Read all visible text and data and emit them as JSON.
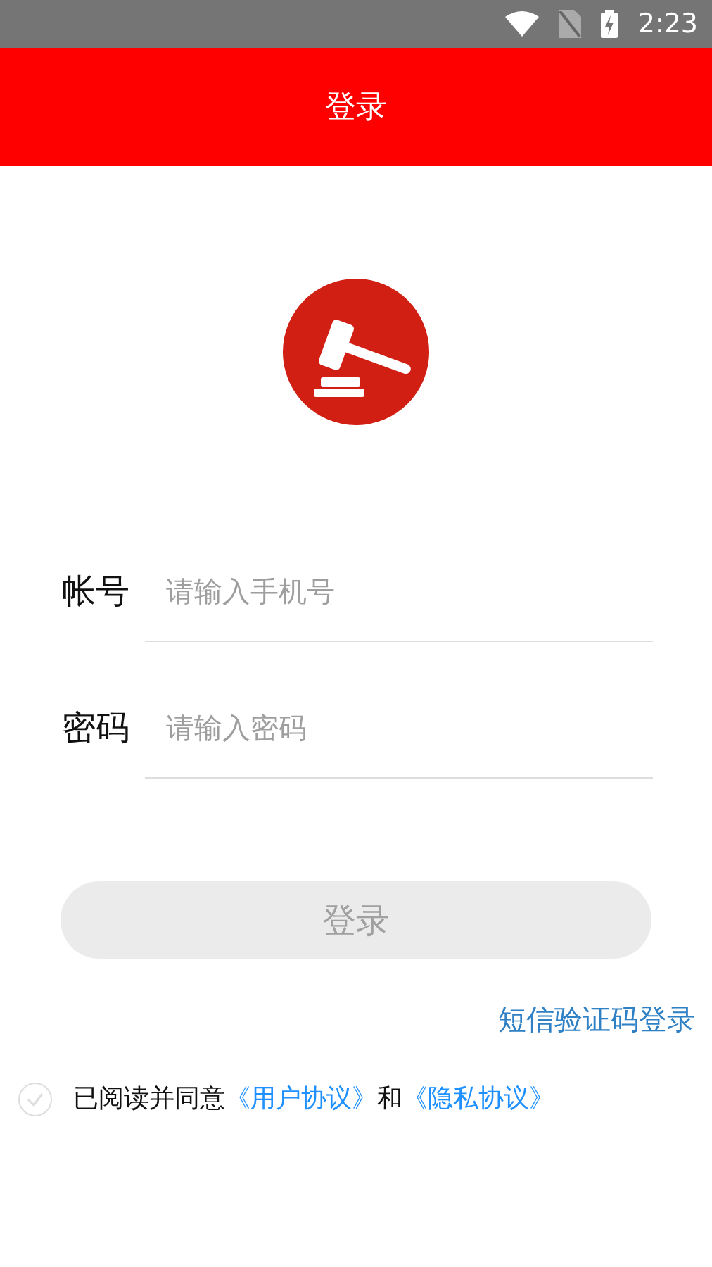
{
  "status_bar": {
    "time": "2:23"
  },
  "header": {
    "title": "登录"
  },
  "fields": [
    {
      "label": "帐号",
      "placeholder": "请输入手机号"
    },
    {
      "label": "密码",
      "placeholder": "请输入密码"
    }
  ],
  "login_button": {
    "label": "登录",
    "disabled": true
  },
  "sms_login_link": "短信验证码登录",
  "agreement": {
    "checked": false,
    "text": "已阅读并同意",
    "user_agreement": "《用户协议》",
    "conjunction": "和",
    "privacy_policy": "《隐私协议》"
  }
}
